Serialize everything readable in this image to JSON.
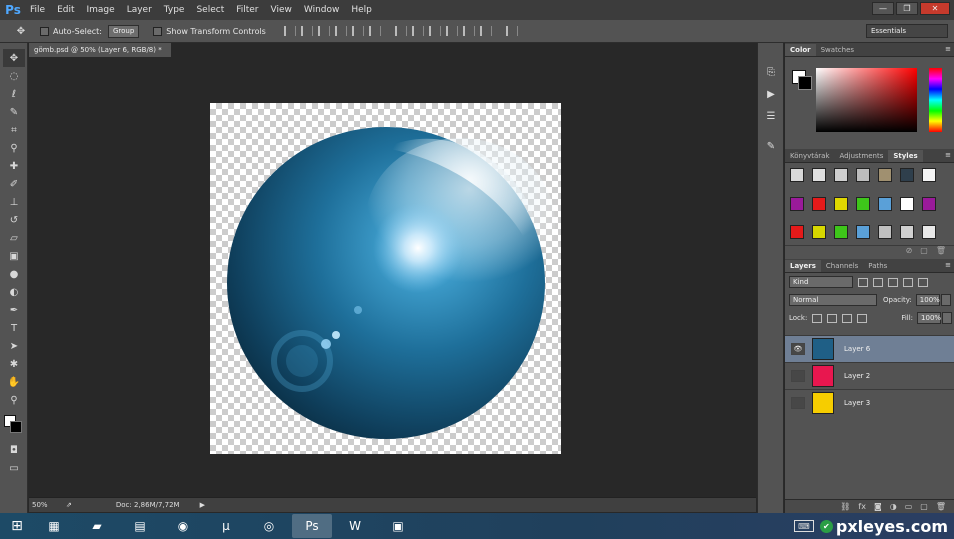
{
  "app": {
    "logo": "Ps"
  },
  "menu": [
    "File",
    "Edit",
    "Image",
    "Layer",
    "Type",
    "Select",
    "Filter",
    "View",
    "Window",
    "Help"
  ],
  "window_controls": {
    "minimize": "—",
    "maximize": "❐",
    "close": "✕"
  },
  "options": {
    "auto_select_label": "Auto-Select:",
    "auto_select_value": "Group",
    "transform_label": "Show Transform Controls",
    "workspace": "Essentials"
  },
  "tools": [
    "move-tool",
    "marquee-tool",
    "lasso-tool",
    "quick-select-tool",
    "crop-tool",
    "eyedropper-tool",
    "healing-tool",
    "brush-tool",
    "clone-stamp-tool",
    "history-brush-tool",
    "eraser-tool",
    "gradient-tool",
    "blur-tool",
    "dodge-tool",
    "pen-tool",
    "type-tool",
    "path-select-tool",
    "shape-tool",
    "hand-tool",
    "zoom-tool"
  ],
  "document": {
    "tab_title": "gömb.psd @ 50% (Layer 6, RGB/8) *"
  },
  "status": {
    "zoom": "50%",
    "doc_size": "Doc: 2,86M/7,72M"
  },
  "panels": {
    "color_tabs": [
      "Color",
      "Swatches"
    ],
    "styles_tabs": [
      "Könyvtárak",
      "Adjustments",
      "Styles"
    ],
    "layers_tabs": [
      "Layers",
      "Channels",
      "Paths"
    ]
  },
  "styles_swatches": [
    "#d8d8d8",
    "#e0e0e0",
    "#cfcfcf",
    "#bdbdbd",
    "#a09070",
    "#2f3f4c",
    "#f5f5f5",
    "#9a1a9a",
    "#e51a1a",
    "#e0d800",
    "#3ec61a",
    "#5aa0d8",
    "#ffffff",
    "#9a1a9a",
    "#e51a1a",
    "#d8d800",
    "#3ec61a",
    "#5aa0d8",
    "#c0c0c0",
    "#d0d0d0",
    "#e8e8e8"
  ],
  "layers": {
    "filter_kind": "Kind",
    "blend_mode": "Normal",
    "opacity_label": "Opacity:",
    "opacity_value": "100%",
    "lock_label": "Lock:",
    "fill_label": "Fill:",
    "fill_value": "100%",
    "items": [
      {
        "name": "Layer 6",
        "thumb_color": "#1f5f86",
        "visible": true,
        "selected": true
      },
      {
        "name": "Layer 2",
        "thumb_color": "#e8174f",
        "visible": false,
        "selected": false
      },
      {
        "name": "Layer 3",
        "thumb_color": "#f6cd00",
        "visible": false,
        "selected": false
      }
    ]
  },
  "taskbar": {
    "apps": [
      "calculator",
      "tablet",
      "explorer",
      "viber",
      "utorrent",
      "chrome",
      "photoshop",
      "word",
      "photos"
    ],
    "watermark": "pxleyes.com"
  },
  "colors": {
    "selection": "#6f7f95",
    "panel": "#535353",
    "canvas_bg": "#282828",
    "accent": "#4fa8ff"
  }
}
